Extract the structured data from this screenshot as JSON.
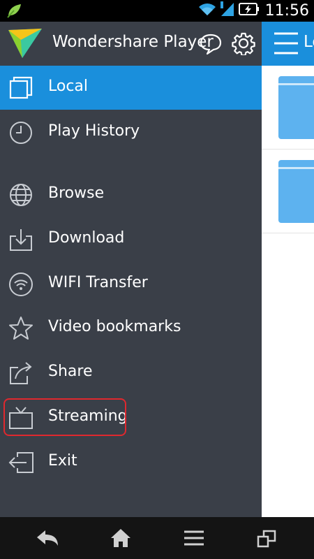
{
  "status_bar": {
    "time": "11:56",
    "icons": [
      "leaf-notification-icon",
      "wifi-icon",
      "signal-icon",
      "battery-charging-icon"
    ]
  },
  "drawer": {
    "app_title": "Wondershare Player",
    "header_icons": [
      "chat-bubble-icon",
      "gear-icon"
    ],
    "items": [
      {
        "label": "Local",
        "icon": "local-files-icon",
        "active": true
      },
      {
        "label": "Play History",
        "icon": "clock-icon",
        "active": false
      },
      {
        "label": "Browse",
        "icon": "globe-icon",
        "active": false
      },
      {
        "label": "Download",
        "icon": "download-icon",
        "active": false
      },
      {
        "label": "WIFI Transfer",
        "icon": "wifi-transfer-icon",
        "active": false
      },
      {
        "label": "Video bookmarks",
        "icon": "star-icon",
        "active": false
      },
      {
        "label": "Share",
        "icon": "share-icon",
        "active": false
      },
      {
        "label": "Streaming",
        "icon": "tv-icon",
        "active": false,
        "highlighted": true
      },
      {
        "label": "Exit",
        "icon": "exit-icon",
        "active": false
      }
    ]
  },
  "main": {
    "toolbar_title": "Local",
    "folders": [
      "folder-icon",
      "folder-icon"
    ]
  },
  "nav_bar": {
    "buttons": [
      "back-icon",
      "home-icon",
      "menu-icon",
      "recent-apps-icon"
    ]
  },
  "colors": {
    "accent": "#1a8fdc",
    "drawer_bg": "#3a3f48",
    "highlight": "#e0282e",
    "folder": "#5db2ef"
  }
}
